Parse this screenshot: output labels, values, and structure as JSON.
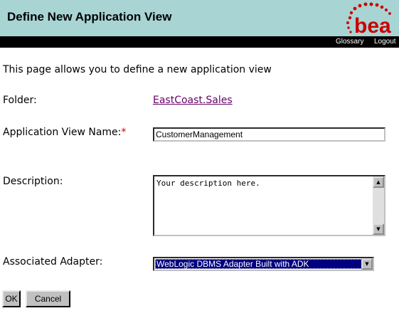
{
  "header": {
    "title": "Define New Application View",
    "logo_text": "bea",
    "brand_color": "#cc0000"
  },
  "nav": {
    "glossary": "Glossary",
    "logout": "Logout"
  },
  "intro": "This page allows you to define a new application view",
  "form": {
    "folder_label": "Folder:",
    "folder_value": "EastCoast.Sales",
    "name_label": "Application View Name:",
    "required_marker": "*",
    "name_value": "CustomerManagement",
    "description_label": "Description:",
    "description_value": "Your description here.",
    "adapter_label": "Associated Adapter:",
    "adapter_value": "WebLogic DBMS Adapter Built with ADK"
  },
  "buttons": {
    "ok": "OK",
    "cancel": "Cancel"
  }
}
